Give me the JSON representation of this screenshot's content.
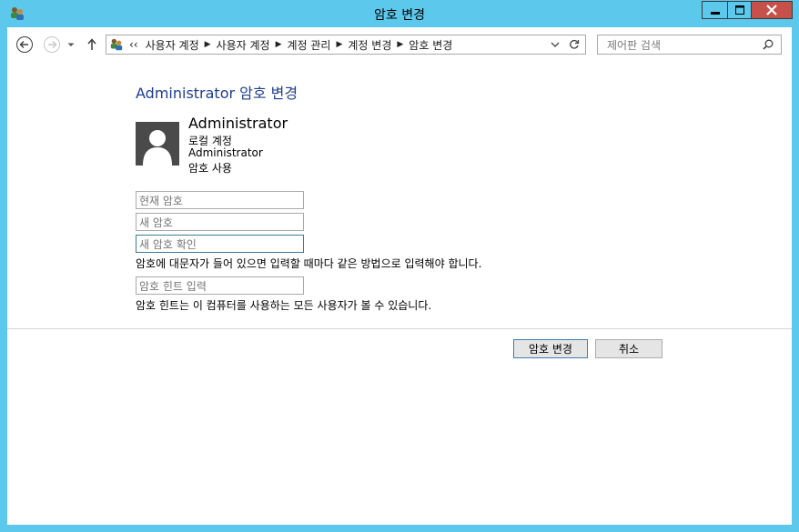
{
  "window": {
    "title": "암호 변경",
    "app_icon": "user-accounts-icon",
    "accent": "#5bc8ec",
    "close_color": "#c7504a"
  },
  "navigation": {
    "back_icon": "back-arrow-icon",
    "forward_icon": "forward-arrow-icon",
    "recent_icon": "chevron-down-icon",
    "up_icon": "up-arrow-icon",
    "overflow": "‹‹",
    "breadcrumbs": [
      "사용자 계정",
      "사용자 계정",
      "계정 관리",
      "계정 변경",
      "암호 변경"
    ],
    "search_placeholder": "제어판 검색"
  },
  "main": {
    "heading": "Administrator 암호 변경",
    "account": {
      "name": "Administrator",
      "type": "로컬 계정",
      "username": "Administrator",
      "status": "암호 사용"
    },
    "fields": {
      "current_password": "현재 암호",
      "new_password": "새 암호",
      "confirm_password": "새 암호 확인",
      "hint": "암호 힌트 입력"
    },
    "notes": {
      "case_sensitive": "암호에 대문자가 들어 있으면 입력할 때마다 같은 방법으로 입력해야 합니다.",
      "hint_visible": "암호 힌트는 이 컴퓨터를 사용하는 모든 사용자가 볼 수 있습니다."
    },
    "buttons": {
      "change": "암호 변경",
      "cancel": "취소"
    }
  }
}
